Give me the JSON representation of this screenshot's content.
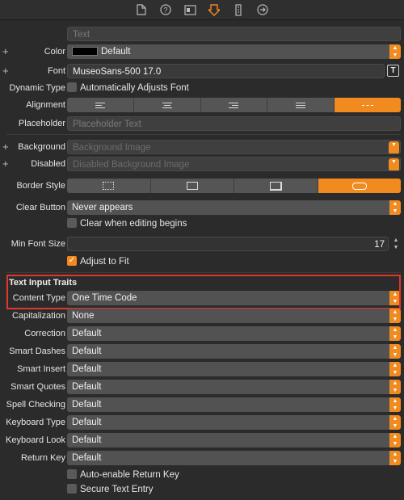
{
  "text_field": {
    "placeholder": "Text"
  },
  "color": {
    "label": "Color",
    "value": "Default"
  },
  "font": {
    "label": "Font",
    "value": "MuseoSans-500 17.0",
    "button": "T"
  },
  "dynamic_type": {
    "label": "Dynamic Type",
    "checkbox": "Automatically Adjusts Font",
    "checked": false
  },
  "alignment": {
    "label": "Alignment",
    "selected": 4
  },
  "placeholder": {
    "label": "Placeholder",
    "value": "Placeholder Text"
  },
  "background": {
    "label": "Background",
    "value": "Background Image"
  },
  "disabled": {
    "label": "Disabled",
    "value": "Disabled Background Image"
  },
  "border_style": {
    "label": "Border Style",
    "selected": 3
  },
  "clear_button": {
    "label": "Clear Button",
    "value": "Never appears",
    "checkbox": "Clear when editing begins",
    "checked": false
  },
  "min_font_size": {
    "label": "Min Font Size",
    "value": "17",
    "checkbox": "Adjust to Fit",
    "checked": true
  },
  "text_input_traits": {
    "title": "Text Input Traits",
    "content_type": {
      "label": "Content Type",
      "value": "One Time Code"
    },
    "capitalization": {
      "label": "Capitalization",
      "value": "None"
    },
    "correction": {
      "label": "Correction",
      "value": "Default"
    },
    "smart_dashes": {
      "label": "Smart Dashes",
      "value": "Default"
    },
    "smart_insert": {
      "label": "Smart Insert",
      "value": "Default"
    },
    "smart_quotes": {
      "label": "Smart Quotes",
      "value": "Default"
    },
    "spell_checking": {
      "label": "Spell Checking",
      "value": "Default"
    },
    "keyboard_type": {
      "label": "Keyboard Type",
      "value": "Default"
    },
    "keyboard_look": {
      "label": "Keyboard Look",
      "value": "Default"
    },
    "return_key": {
      "label": "Return Key",
      "value": "Default"
    },
    "auto_enable_return": {
      "label": "Auto-enable Return Key",
      "checked": false
    },
    "secure_text": {
      "label": "Secure Text Entry",
      "checked": false
    }
  },
  "colors": {
    "accent": "#f28b1f",
    "highlight": "#e0362b",
    "background": "#2b2b2b"
  }
}
